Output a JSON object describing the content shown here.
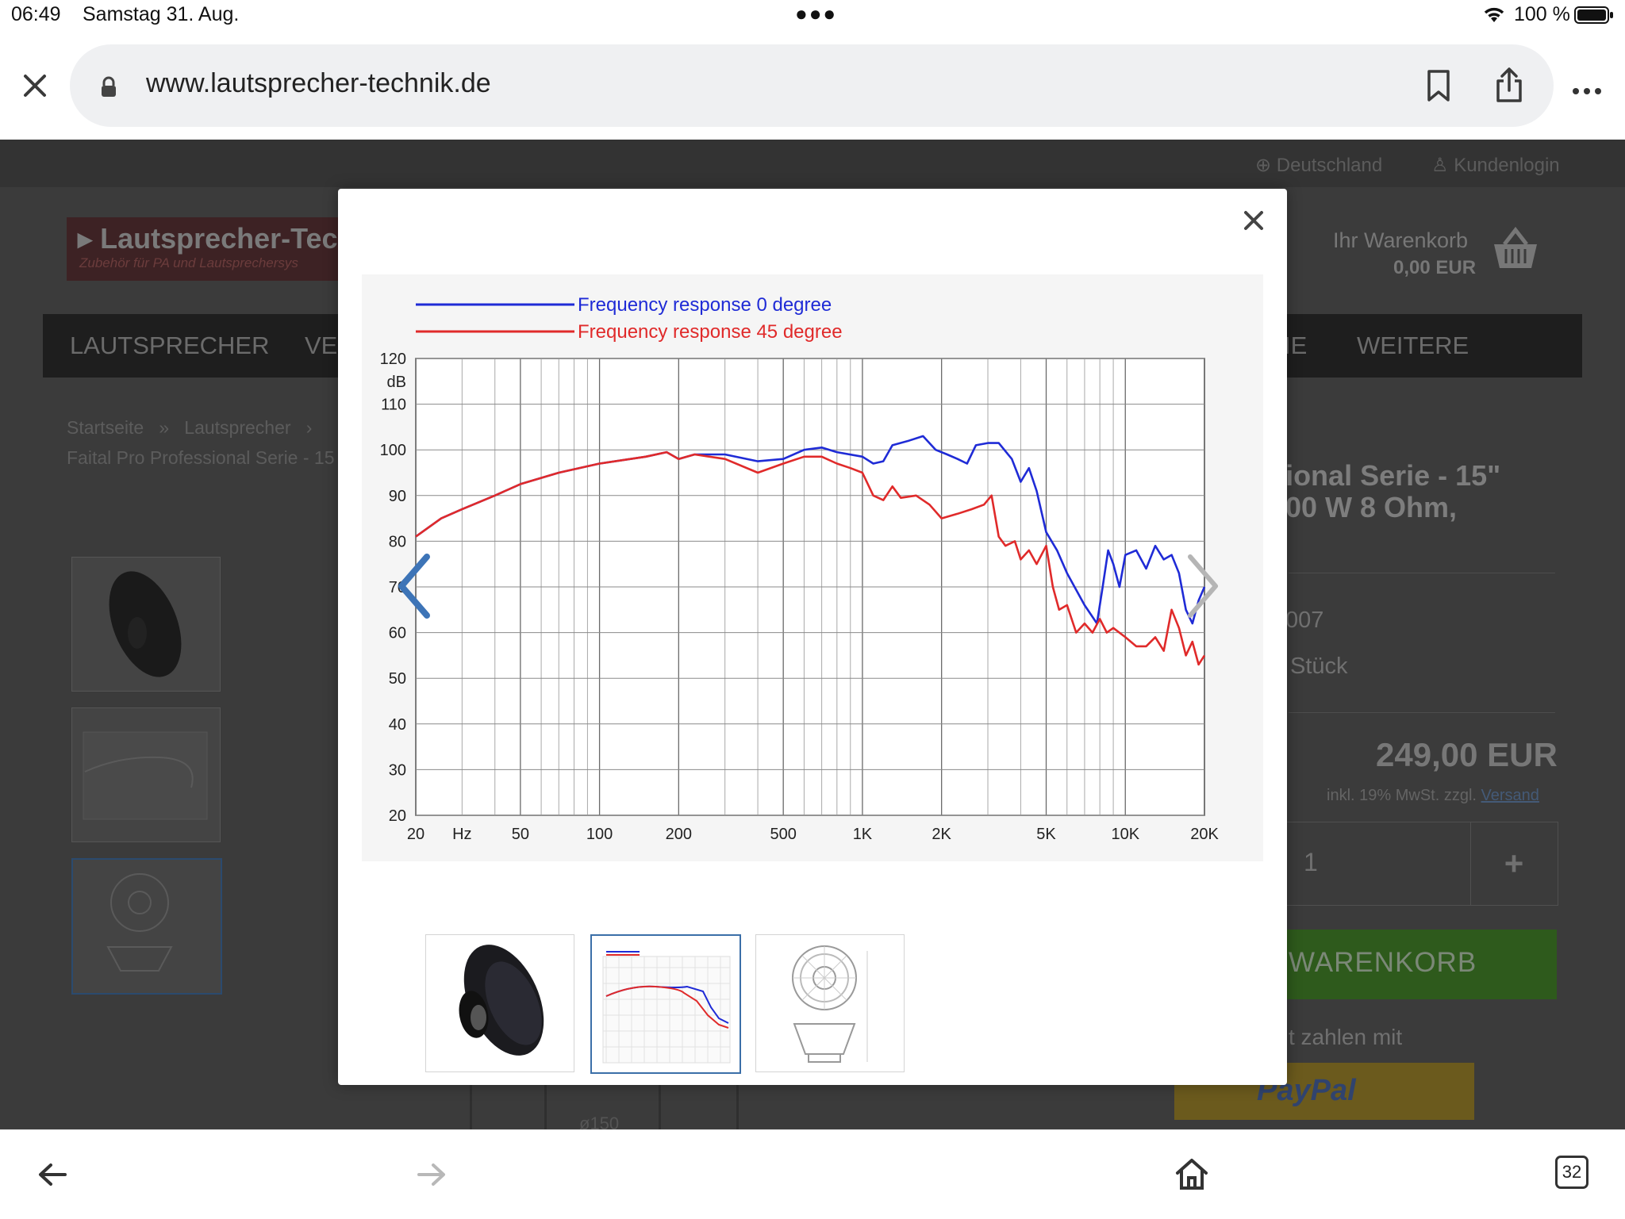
{
  "status_bar": {
    "time": "06:49",
    "date": "Samstag 31. Aug.",
    "battery": "100 %"
  },
  "toolbar": {
    "url": "www.lautsprecher-technik.de",
    "tab_count": "32"
  },
  "page": {
    "country": "Deutschland",
    "login": "Kundenlogin",
    "logo_title": "Lautsprecher-Tec",
    "logo_subtitle": "Zubehör für PA und Lautsprechersys",
    "cart_title": "Ihr Warenkorb",
    "cart_total": "0,00 EUR",
    "nav_items": [
      "LAUTSPRECHER",
      "VE",
      "IE",
      "WEITERE"
    ],
    "breadcrumb_home": "Startseite",
    "breadcrumb_sep": "»",
    "breadcrumb_category": "Lautsprecher",
    "breadcrumb_sep2": "›",
    "breadcrumb_product": "Faital Pro Professional Serie - 15",
    "product_title_1": "essional Serie - 15\"",
    "product_title_2": "00 W 8 Ohm,",
    "sku_partial": "007",
    "stock_partial": "Stück",
    "price": "249,00 EUR",
    "tax_note": "inkl. 19% MwSt. zzgl.",
    "shipping_link": "Versand",
    "quantity": "1",
    "qty_plus": "+",
    "add_to_cart": "WARENKORB",
    "pay_with": "t zahlen mit",
    "paypal": "PayPal",
    "bg_dimension": "ø150"
  },
  "modal": {
    "close_glyph": "×"
  },
  "chart_data": {
    "type": "line",
    "x_scale": "log",
    "xlim": [
      20,
      20000
    ],
    "ylim": [
      20,
      120
    ],
    "ylabel": "dB",
    "x_ticks": [
      {
        "v": 20,
        "label": "20"
      },
      {
        "v": 30,
        "label": "Hz"
      },
      {
        "v": 50,
        "label": "50"
      },
      {
        "v": 100,
        "label": "100"
      },
      {
        "v": 200,
        "label": "200"
      },
      {
        "v": 500,
        "label": "500"
      },
      {
        "v": 1000,
        "label": "1K"
      },
      {
        "v": 2000,
        "label": "2K"
      },
      {
        "v": 5000,
        "label": "5K"
      },
      {
        "v": 10000,
        "label": "10K"
      },
      {
        "v": 20000,
        "label": "20K"
      }
    ],
    "y_ticks": [
      20,
      30,
      40,
      50,
      60,
      70,
      80,
      90,
      100,
      110,
      120
    ],
    "grid": true,
    "legend_position": "top-left",
    "series": [
      {
        "name": "Frequency response 0 degree",
        "color": "#1f2bd6",
        "points": [
          [
            20,
            81
          ],
          [
            25,
            85
          ],
          [
            30,
            87
          ],
          [
            40,
            90
          ],
          [
            50,
            92.5
          ],
          [
            70,
            95
          ],
          [
            100,
            97
          ],
          [
            150,
            98.5
          ],
          [
            180,
            99.5
          ],
          [
            200,
            98
          ],
          [
            230,
            99
          ],
          [
            300,
            99
          ],
          [
            400,
            97.5
          ],
          [
            500,
            98
          ],
          [
            600,
            100
          ],
          [
            700,
            100.5
          ],
          [
            800,
            99.5
          ],
          [
            1000,
            98.5
          ],
          [
            1100,
            97
          ],
          [
            1200,
            97.5
          ],
          [
            1300,
            101
          ],
          [
            1500,
            102
          ],
          [
            1700,
            103
          ],
          [
            1900,
            100
          ],
          [
            2100,
            99
          ],
          [
            2300,
            98
          ],
          [
            2500,
            97
          ],
          [
            2700,
            101
          ],
          [
            3000,
            101.5
          ],
          [
            3300,
            101.5
          ],
          [
            3700,
            98
          ],
          [
            4000,
            93
          ],
          [
            4300,
            96
          ],
          [
            4600,
            91
          ],
          [
            5000,
            82
          ],
          [
            5500,
            78
          ],
          [
            6000,
            73
          ],
          [
            7000,
            66
          ],
          [
            7800,
            62
          ],
          [
            8200,
            70
          ],
          [
            8600,
            78
          ],
          [
            9000,
            75
          ],
          [
            9500,
            70
          ],
          [
            10000,
            77
          ],
          [
            11000,
            78
          ],
          [
            12000,
            74
          ],
          [
            13000,
            79
          ],
          [
            14000,
            76
          ],
          [
            15000,
            77
          ],
          [
            16000,
            73
          ],
          [
            17000,
            65
          ],
          [
            18000,
            62
          ],
          [
            19000,
            67
          ],
          [
            20000,
            70
          ]
        ]
      },
      {
        "name": "Frequency response 45 degree",
        "color": "#e02a2a",
        "points": [
          [
            20,
            81
          ],
          [
            25,
            85
          ],
          [
            30,
            87
          ],
          [
            40,
            90
          ],
          [
            50,
            92.5
          ],
          [
            70,
            95
          ],
          [
            100,
            97
          ],
          [
            150,
            98.5
          ],
          [
            180,
            99.5
          ],
          [
            200,
            98
          ],
          [
            230,
            99
          ],
          [
            300,
            98
          ],
          [
            400,
            95
          ],
          [
            500,
            97
          ],
          [
            600,
            98.5
          ],
          [
            700,
            98.5
          ],
          [
            800,
            97
          ],
          [
            900,
            96
          ],
          [
            1000,
            95
          ],
          [
            1100,
            90
          ],
          [
            1200,
            89
          ],
          [
            1300,
            92
          ],
          [
            1400,
            89.5
          ],
          [
            1600,
            90
          ],
          [
            1800,
            88
          ],
          [
            2000,
            85
          ],
          [
            2300,
            86
          ],
          [
            2600,
            87
          ],
          [
            2900,
            88
          ],
          [
            3100,
            90
          ],
          [
            3300,
            81
          ],
          [
            3500,
            79
          ],
          [
            3800,
            80
          ],
          [
            4000,
            76
          ],
          [
            4300,
            78
          ],
          [
            4600,
            75
          ],
          [
            5000,
            79
          ],
          [
            5300,
            70
          ],
          [
            5600,
            65
          ],
          [
            6000,
            66
          ],
          [
            6500,
            60
          ],
          [
            7000,
            62
          ],
          [
            7500,
            60
          ],
          [
            8000,
            63
          ],
          [
            8500,
            60
          ],
          [
            9000,
            61
          ],
          [
            10000,
            59
          ],
          [
            11000,
            57
          ],
          [
            12000,
            57
          ],
          [
            13000,
            59
          ],
          [
            14000,
            56
          ],
          [
            15000,
            65
          ],
          [
            16000,
            61
          ],
          [
            17000,
            55
          ],
          [
            18000,
            58
          ],
          [
            19000,
            53
          ],
          [
            20000,
            55
          ]
        ]
      }
    ]
  }
}
